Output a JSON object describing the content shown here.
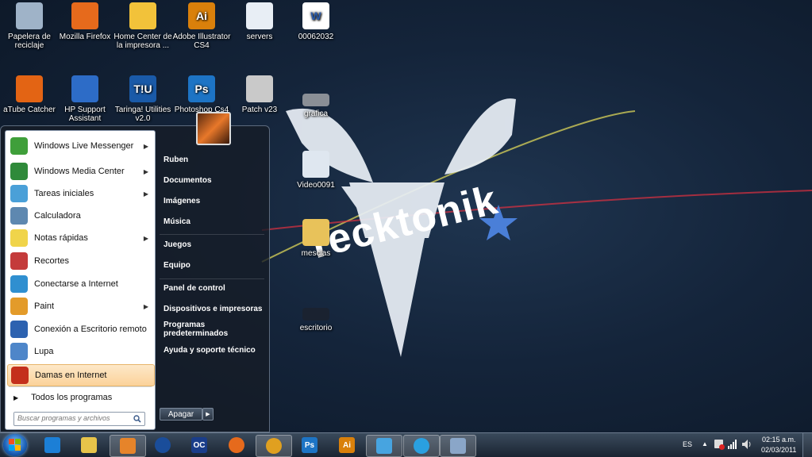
{
  "wallpaper": {
    "brand_text": "Tecktonik"
  },
  "desktop_icons": [
    {
      "label": "Papelera de reciclaje",
      "icon": "recycle-bin-icon"
    },
    {
      "label": "Mozilla Firefox",
      "icon": "firefox-icon"
    },
    {
      "label": "Home Center de la impresora ...",
      "icon": "printer-center-icon"
    },
    {
      "label": "Adobe Illustrator CS4",
      "icon": "illustrator-icon"
    },
    {
      "label": "servers",
      "icon": "document-icon"
    },
    {
      "label": "00062032",
      "icon": "word-doc-icon"
    },
    {
      "label": "aTube Catcher",
      "icon": "atube-icon"
    },
    {
      "label": "HP Support Assistant",
      "icon": "hp-support-icon"
    },
    {
      "label": "Taringa! Utilities v2.0",
      "icon": "taringa-icon"
    },
    {
      "label": "Photoshop Cs4",
      "icon": "photoshop-icon"
    },
    {
      "label": "Patch v23",
      "icon": "counter-strike-icon"
    },
    {
      "label": "grafica",
      "icon": "image-icon"
    },
    {
      "label": "Video0091",
      "icon": "video-file-icon"
    },
    {
      "label": "mesclas",
      "icon": "folder-icon"
    },
    {
      "label": "escritorio",
      "icon": "image-icon"
    }
  ],
  "start_menu": {
    "programs": [
      {
        "label": "Windows Live Messenger",
        "has_arrow": true
      },
      {
        "label": "Windows Media Center",
        "has_arrow": true
      },
      {
        "label": "Tareas iniciales",
        "has_arrow": true
      },
      {
        "label": "Calculadora",
        "has_arrow": false
      },
      {
        "label": "Notas rápidas",
        "has_arrow": true
      },
      {
        "label": "Recortes",
        "has_arrow": false
      },
      {
        "label": "Conectarse a Internet",
        "has_arrow": false
      },
      {
        "label": "Paint",
        "has_arrow": true
      },
      {
        "label": "Conexión a Escritorio remoto",
        "has_arrow": false
      },
      {
        "label": "Lupa",
        "has_arrow": false
      },
      {
        "label": "Damas en Internet",
        "has_arrow": false
      }
    ],
    "all_programs": "Todos los programas",
    "search_placeholder": "Buscar programas y archivos",
    "right_items": [
      "Ruben",
      "Documentos",
      "Imágenes",
      "Música",
      "Juegos",
      "Equipo",
      "Panel de control",
      "Dispositivos e impresoras",
      "Programas predeterminados",
      "Ayuda y soporte técnico"
    ],
    "shutdown_label": "Apagar",
    "arrow_glyph": "▶"
  },
  "taskbar": {
    "pinned": [
      "internet-explorer-icon",
      "explorer-folder-icon",
      "media-player-icon",
      "hp-icon",
      "oc-icon",
      "firefox-icon",
      "chrome-icon",
      "photoshop-icon",
      "illustrator-icon",
      "messenger-icon",
      "skype-icon",
      "paint-icon"
    ],
    "ps_label": "Ps",
    "ai_label": "Ai",
    "oc_label": "OC",
    "language": "ES",
    "time": "02:15 a.m.",
    "date": "02/03/2011"
  }
}
